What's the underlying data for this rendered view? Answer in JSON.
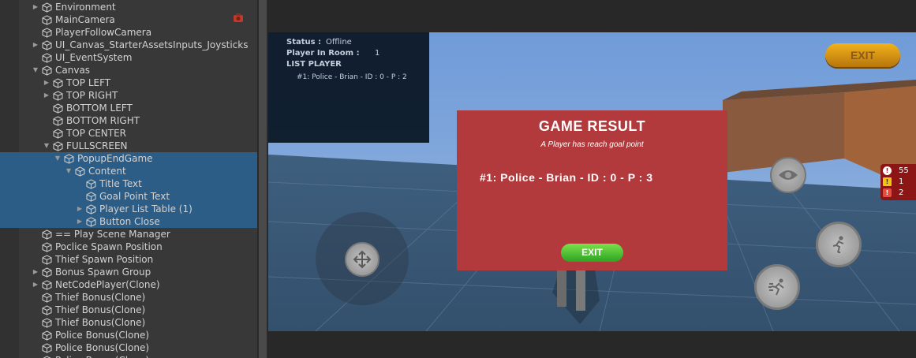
{
  "hierarchy": {
    "items": [
      {
        "label": "Environment",
        "expander": "collapsed"
      },
      {
        "label": "MainCamera",
        "expander": "none"
      },
      {
        "label": "PlayerFollowCamera",
        "expander": "none"
      },
      {
        "label": "UI_Canvas_StarterAssetsInputs_Joysticks",
        "expander": "collapsed"
      },
      {
        "label": "UI_EventSystem",
        "expander": "none"
      },
      {
        "label": "Canvas",
        "expander": "expanded"
      },
      {
        "label": "TOP LEFT",
        "expander": "collapsed"
      },
      {
        "label": "TOP RIGHT",
        "expander": "collapsed"
      },
      {
        "label": "BOTTOM LEFT",
        "expander": "none"
      },
      {
        "label": "BOTTOM RIGHT",
        "expander": "none"
      },
      {
        "label": "TOP CENTER",
        "expander": "none"
      },
      {
        "label": "FULLSCREEN",
        "expander": "expanded"
      },
      {
        "label": "PopupEndGame",
        "expander": "expanded"
      },
      {
        "label": "Content",
        "expander": "expanded"
      },
      {
        "label": "Title Text",
        "expander": "none"
      },
      {
        "label": "Goal Point Text",
        "expander": "none"
      },
      {
        "label": "Player List Table (1)",
        "expander": "collapsed"
      },
      {
        "label": "Button Close",
        "expander": "collapsed"
      },
      {
        "label": "== Play Scene Manager",
        "expander": "none"
      },
      {
        "label": "Poclice Spawn Position",
        "expander": "none"
      },
      {
        "label": "Thief Spawn Position",
        "expander": "none"
      },
      {
        "label": "Bonus Spawn Group",
        "expander": "collapsed"
      },
      {
        "label": "NetCodePlayer(Clone)",
        "expander": "collapsed"
      },
      {
        "label": "Thief Bonus(Clone)",
        "expander": "none"
      },
      {
        "label": "Thief Bonus(Clone)",
        "expander": "none"
      },
      {
        "label": "Thief Bonus(Clone)",
        "expander": "none"
      },
      {
        "label": "Police Bonus(Clone)",
        "expander": "none"
      },
      {
        "label": "Police Bonus(Clone)",
        "expander": "none"
      },
      {
        "label": "Police Bonus(Clone)",
        "expander": "none"
      }
    ],
    "selected_labels": [
      "PopupEndGame",
      "Content",
      "Title Text",
      "Goal Point Text",
      "Player List Table (1)",
      "Button Close"
    ]
  },
  "game": {
    "status": {
      "status_label": "Status :",
      "status_value": "Offline",
      "players_label": "Player In Room :",
      "players_value": "1",
      "list_label": "LIST PLAYER",
      "list_entry": "#1: Police - Brian - ID : 0 - P : 2"
    },
    "exit_top_label": "EXIT",
    "popup": {
      "title": "GAME RESULT",
      "subtitle": "A Player has reach goal point",
      "entry": "#1: Police - Brian - ID : 0 - P : 3",
      "exit_label": "EXIT"
    },
    "issues": {
      "errors": "55",
      "warnings": "1",
      "infos": "2"
    }
  },
  "colors": {
    "popup_bg": "#b23a3c",
    "selection": "#2c5d87",
    "exit_top": "#f1b21c",
    "exit_popup": "#4cc035",
    "issues_bg": "#8c1515"
  },
  "icons": {
    "hierarchy_item": "gameobject-cube-icon",
    "recording": "recording-icon",
    "joystick": "move-arrows-icon",
    "camera_toggle": "eye-icon",
    "run": "run-icon",
    "sprint": "sprint-icon",
    "error": "error-icon",
    "warning": "warning-icon",
    "info": "info-icon"
  }
}
